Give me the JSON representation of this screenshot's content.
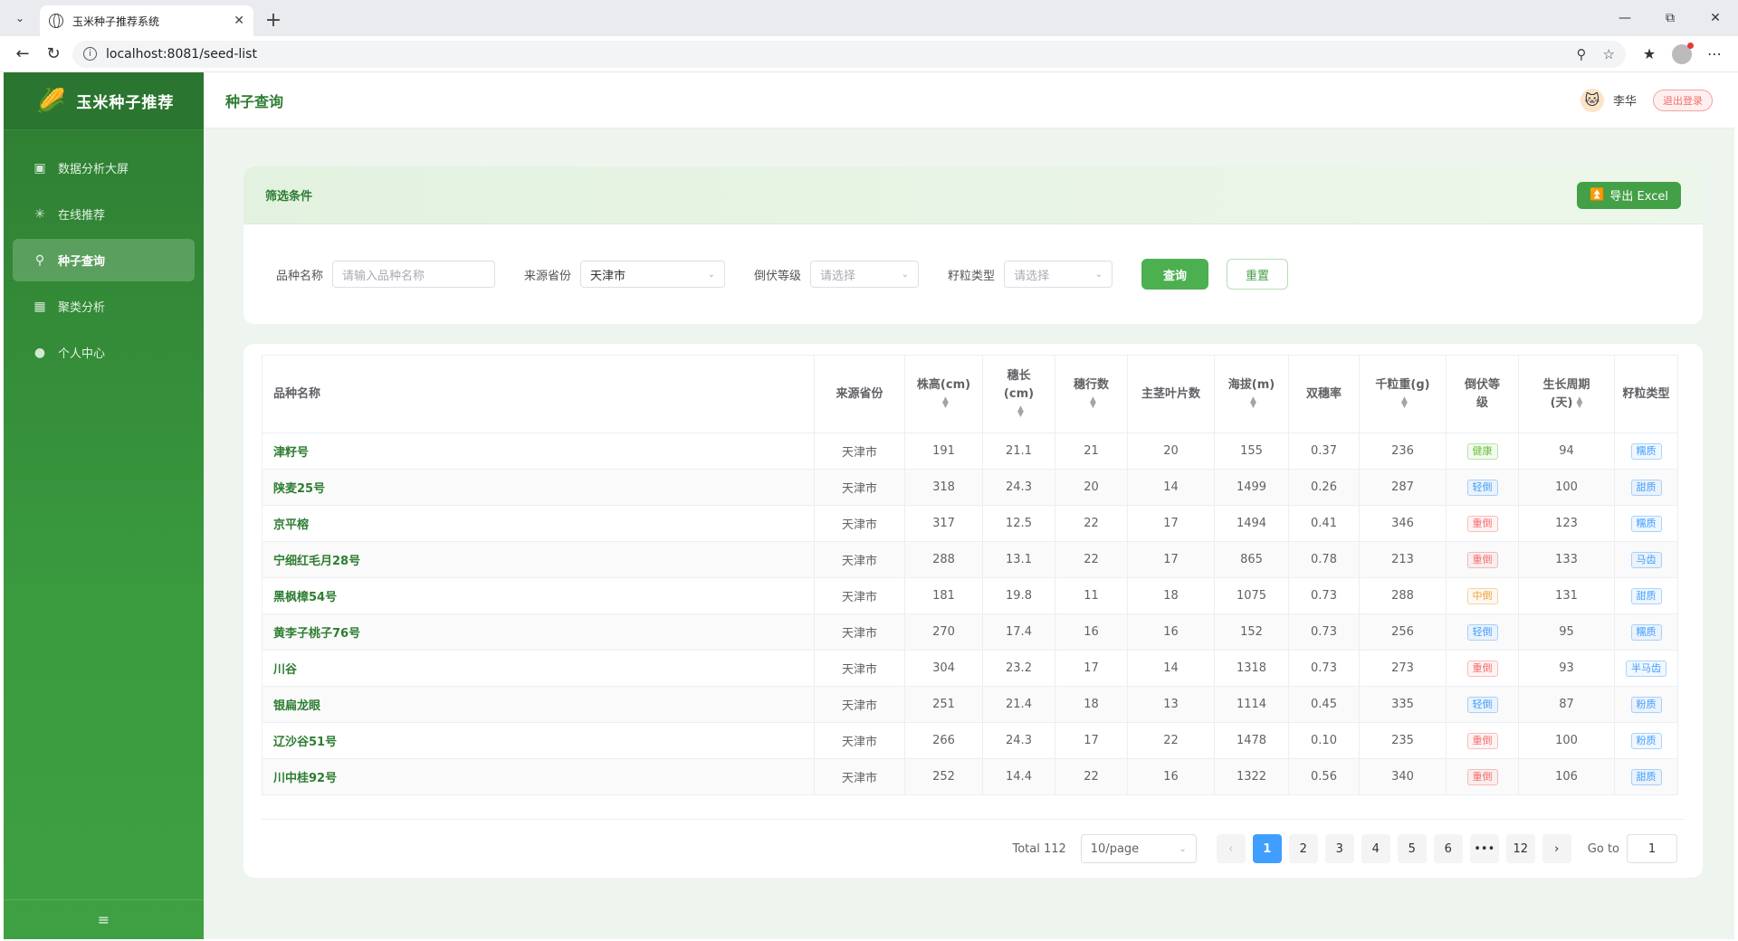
{
  "browser": {
    "tab_title": "玉米种子推荐系统",
    "url": "localhost:8081/seed-list"
  },
  "app": {
    "logo_text": "玉米种子推荐",
    "logo_icon": "corn-icon"
  },
  "sidebar": {
    "items": [
      {
        "label": "数据分析大屏",
        "icon": "monitor-icon"
      },
      {
        "label": "在线推荐",
        "icon": "sparkle-icon"
      },
      {
        "label": "种子查询",
        "icon": "search-icon",
        "active": true
      },
      {
        "label": "聚类分析",
        "icon": "grid-icon"
      },
      {
        "label": "个人中心",
        "icon": "user-icon"
      }
    ]
  },
  "header": {
    "title": "种子查询",
    "user_name": "李华",
    "logout_label": "退出登录"
  },
  "filter": {
    "title": "筛选条件",
    "export_label": "导出 Excel",
    "variety_label": "品种名称",
    "variety_placeholder": "请输入品种名称",
    "province_label": "来源省份",
    "province_value": "天津市",
    "lodging_label": "倒伏等级",
    "lodging_placeholder": "请选择",
    "grain_label": "籽粒类型",
    "grain_placeholder": "请选择",
    "query_label": "查询",
    "reset_label": "重置"
  },
  "table": {
    "headers": [
      "品种名称",
      "来源省份",
      "株高(cm)",
      "穗长\n(cm)",
      "穗行数",
      "主茎叶片数",
      "海拔(m)",
      "双穗率",
      "千粒重(g)",
      "倒伏等\n级",
      "生长周期\n(天)",
      "籽粒类型"
    ],
    "rows": [
      [
        "津籽号",
        "天津市",
        "191",
        "21.1",
        "21",
        "20",
        "155",
        "0.37",
        "236",
        "健康",
        "94",
        "糯质"
      ],
      [
        "陕麦25号",
        "天津市",
        "318",
        "24.3",
        "20",
        "14",
        "1499",
        "0.26",
        "287",
        "轻倒",
        "100",
        "甜质"
      ],
      [
        "京平榕",
        "天津市",
        "317",
        "12.5",
        "22",
        "17",
        "1494",
        "0.41",
        "346",
        "重倒",
        "123",
        "糯质"
      ],
      [
        "宁细红毛月28号",
        "天津市",
        "288",
        "13.1",
        "22",
        "17",
        "865",
        "0.78",
        "213",
        "重倒",
        "133",
        "马齿"
      ],
      [
        "黑枫樟54号",
        "天津市",
        "181",
        "19.8",
        "11",
        "18",
        "1075",
        "0.73",
        "288",
        "中倒",
        "131",
        "甜质"
      ],
      [
        "黄李子桃子76号",
        "天津市",
        "270",
        "17.4",
        "16",
        "16",
        "152",
        "0.73",
        "256",
        "轻倒",
        "95",
        "糯质"
      ],
      [
        "川谷",
        "天津市",
        "304",
        "23.2",
        "17",
        "14",
        "1318",
        "0.73",
        "273",
        "重倒",
        "93",
        "半马齿"
      ],
      [
        "银扁龙眼",
        "天津市",
        "251",
        "21.4",
        "18",
        "13",
        "1114",
        "0.45",
        "335",
        "轻倒",
        "87",
        "粉质"
      ],
      [
        "辽沙谷51号",
        "天津市",
        "266",
        "24.3",
        "17",
        "22",
        "1478",
        "0.10",
        "235",
        "重倒",
        "100",
        "粉质"
      ],
      [
        "川中桂92号",
        "天津市",
        "252",
        "14.4",
        "22",
        "16",
        "1322",
        "0.56",
        "340",
        "重倒",
        "106",
        "甜质"
      ]
    ],
    "lodging_colors": {
      "健康": "#67c23a",
      "轻倒": "#409eff",
      "中倒": "#e6a23c",
      "重倒": "#f56c6c"
    },
    "grain_color": "#409eff"
  },
  "pagination": {
    "total_label": "Total 112",
    "page_size": "10/page",
    "pages": [
      "1",
      "2",
      "3",
      "4",
      "5",
      "6",
      "•••",
      "12"
    ],
    "current": "1",
    "goto_label": "Go to",
    "goto_value": "1"
  }
}
